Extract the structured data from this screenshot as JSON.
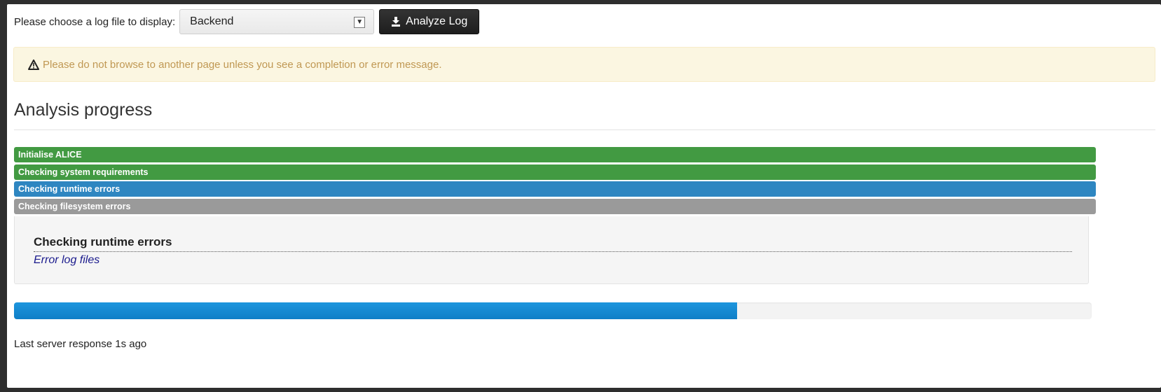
{
  "toolbar": {
    "choose_label": "Please choose a log file to display:",
    "selected_log": "Backend",
    "analyze_label": "Analyze Log"
  },
  "alert": {
    "message": "Please do not browse to another page unless you see a completion or error message."
  },
  "section": {
    "title": "Analysis progress"
  },
  "steps": [
    {
      "label": "Initialise ALICE",
      "state": "done"
    },
    {
      "label": "Checking system requirements",
      "state": "done"
    },
    {
      "label": "Checking runtime errors",
      "state": "active"
    },
    {
      "label": "Checking filesystem errors",
      "state": "pending"
    }
  ],
  "detail": {
    "title": "Checking runtime errors",
    "link": "Error log files"
  },
  "progress": {
    "fraction": 0.671
  },
  "status": {
    "text": "Last server response 1s ago"
  },
  "colors": {
    "done": "#429a42",
    "active": "#2e86c1",
    "pending": "#9a9a9a",
    "progress": "#1d95dd",
    "warning_text": "#c09853",
    "warning_bg": "#fbf6e1"
  }
}
